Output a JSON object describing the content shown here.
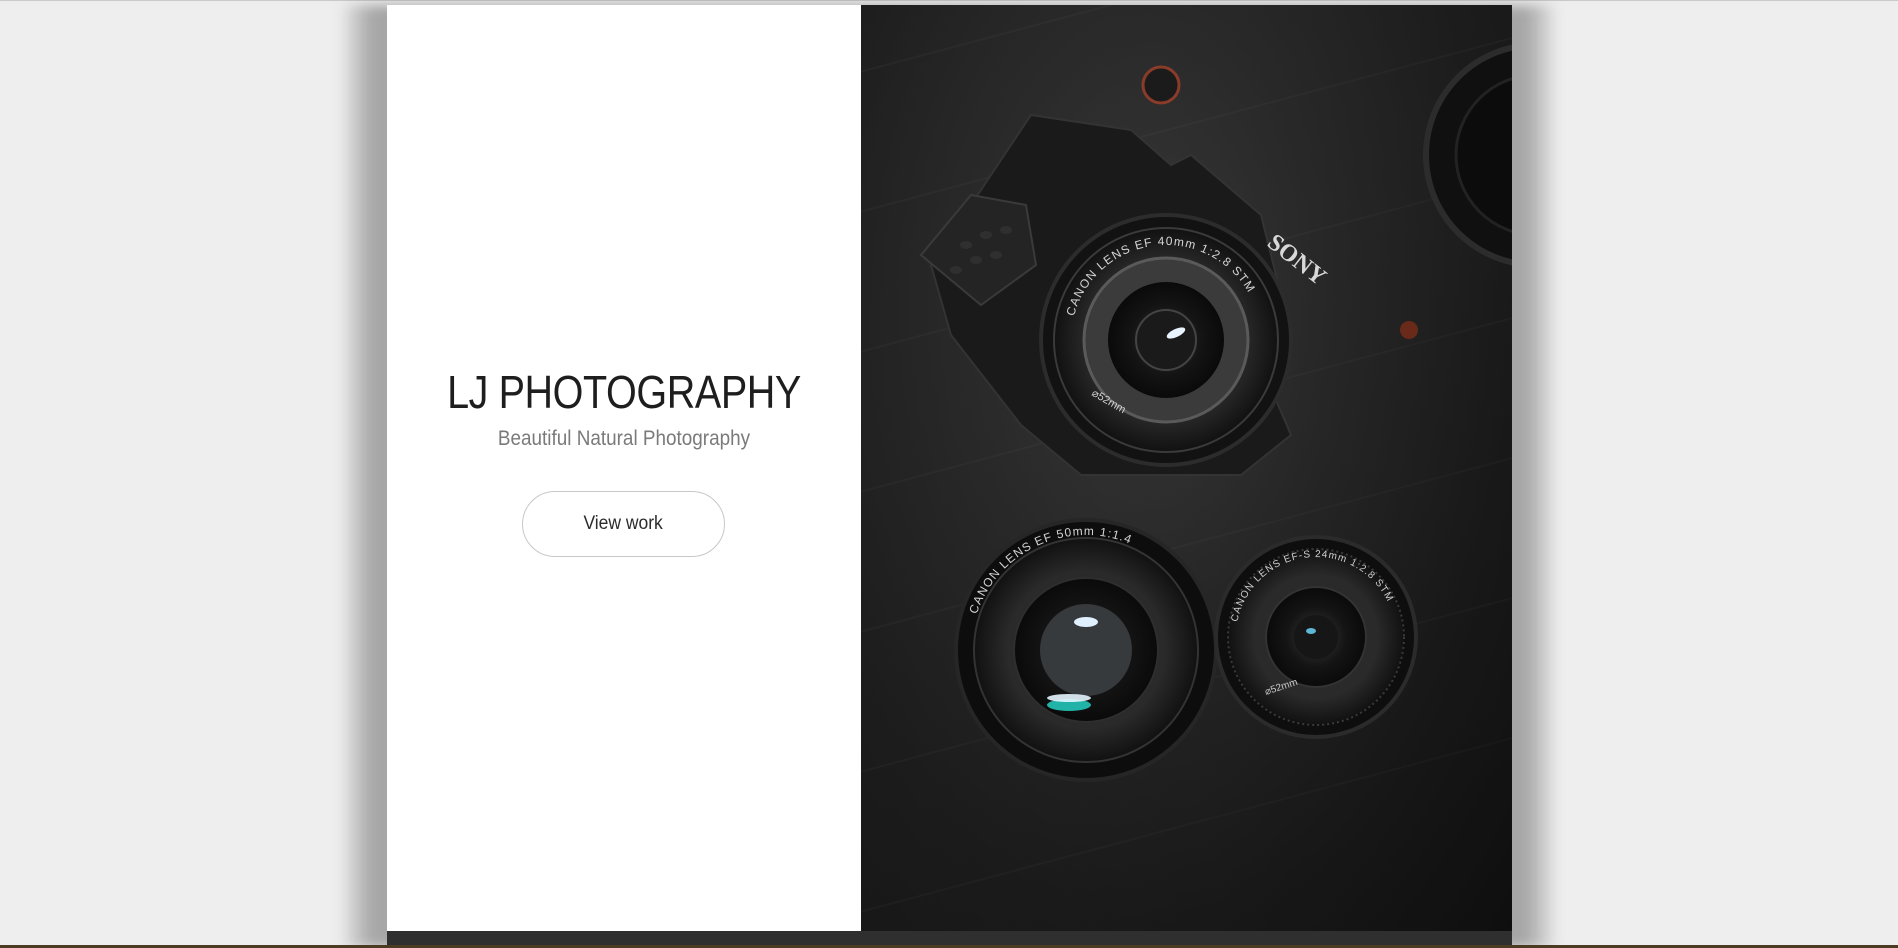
{
  "hero": {
    "title": "LJ PHOTOGRAPHY",
    "subtitle": "Beautiful Natural Photography",
    "button_label": "View work"
  },
  "image": {
    "subject": "camera-with-lenses-photo",
    "lens_labels": {
      "main_body": "SONY",
      "lens_1": "CANON LENS EF 40mm 1:2.8 STM",
      "lens_1_size": "⌀52mm",
      "lens_2": "CANON LENS EF 50mm 1:1.4",
      "lens_3": "CANON LENS EF-S 24mm 1:2.8 STM",
      "lens_3_size": "⌀52mm"
    }
  },
  "colors": {
    "background": "#eeeeee",
    "panel": "#ffffff",
    "title_text": "#1e1e1e",
    "subtitle_text": "#7a7a7a",
    "photo_dark": "#1d1d1d",
    "teal_accent": "#22b3a8"
  }
}
